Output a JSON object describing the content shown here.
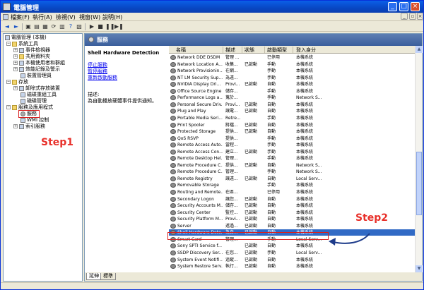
{
  "window": {
    "title": "電腦管理"
  },
  "menu": [
    "檔案(F)",
    "執行(A)",
    "檢視(V)",
    "視窗(W)",
    "說明(H)"
  ],
  "tree": {
    "root": "電腦管理 (本機)",
    "items": [
      "系統工具",
      "事件檢視器",
      "共用資料夾",
      "本機使用者和群組",
      "效能記錄及警示",
      "裝置管理員",
      "存放",
      "卸除式存放裝置",
      "磁碟重組工具",
      "磁碟管理",
      "服務及應用程式",
      "服務",
      "WMI 控制",
      "索引服務"
    ]
  },
  "annotations": {
    "step1": "Step1",
    "step2": "Step2"
  },
  "panel": {
    "title": "服務",
    "selected_service": "Shell Hardware Detection",
    "links": [
      "停止服務",
      "暫停服務",
      "重新啟動服務"
    ],
    "desc_label": "描述:",
    "desc_text": "為自動播放硬體事件提供通知。"
  },
  "columns": [
    "名稱",
    "描述",
    "狀態",
    "啟動類型",
    "登入身分"
  ],
  "services": [
    {
      "name": "Network DDE DSDM",
      "desc": "管理 ...",
      "status": "",
      "startup": "已停用",
      "logon": "本機系統"
    },
    {
      "name": "Network Location A...",
      "desc": "收集...",
      "status": "已啟動",
      "startup": "手動",
      "logon": "本機系統"
    },
    {
      "name": "Network Provisionin...",
      "desc": "在網...",
      "status": "",
      "startup": "手動",
      "logon": "本機系統"
    },
    {
      "name": "NT LM Security Sup...",
      "desc": "為遠...",
      "status": "",
      "startup": "手動",
      "logon": "本機系統"
    },
    {
      "name": "NVIDIA Display Dri...",
      "desc": "Provi...",
      "status": "已啟動",
      "startup": "自動",
      "logon": "本機系統"
    },
    {
      "name": "Office Source Engine",
      "desc": "儲存...",
      "status": "",
      "startup": "手動",
      "logon": "本機系統"
    },
    {
      "name": "Performance Logs a...",
      "desc": "蒐於...",
      "status": "",
      "startup": "手動",
      "logon": "Network S..."
    },
    {
      "name": "Personal Secure Driv...",
      "desc": "Provi...",
      "status": "已啟動",
      "startup": "自動",
      "logon": "本機系統"
    },
    {
      "name": "Plug and Play",
      "desc": "讓電...",
      "status": "已啟動",
      "startup": "自動",
      "logon": "本機系統"
    },
    {
      "name": "Portable Media Seri...",
      "desc": "Retre...",
      "status": "",
      "startup": "手動",
      "logon": "本機系統"
    },
    {
      "name": "Print Spooler",
      "desc": "將檔...",
      "status": "已啟動",
      "startup": "自動",
      "logon": "本機系統"
    },
    {
      "name": "Protected Storage",
      "desc": "提供...",
      "status": "已啟動",
      "startup": "自動",
      "logon": "本機系統"
    },
    {
      "name": "QoS RSVP",
      "desc": "提供...",
      "status": "",
      "startup": "手動",
      "logon": "本機系統"
    },
    {
      "name": "Remote Access Auto...",
      "desc": "當程...",
      "status": "",
      "startup": "手動",
      "logon": "本機系統"
    },
    {
      "name": "Remote Access Con...",
      "desc": "建立...",
      "status": "已啟動",
      "startup": "手動",
      "logon": "本機系統"
    },
    {
      "name": "Remote Desktop Hel...",
      "desc": "管理...",
      "status": "",
      "startup": "手動",
      "logon": "本機系統"
    },
    {
      "name": "Remote Procedure C...",
      "desc": "提供...",
      "status": "已啟動",
      "startup": "自動",
      "logon": "Network S..."
    },
    {
      "name": "Remote Procedure C...",
      "desc": "管理...",
      "status": "",
      "startup": "手動",
      "logon": "Network S..."
    },
    {
      "name": "Remote Registry",
      "desc": "讓遠...",
      "status": "已啟動",
      "startup": "自動",
      "logon": "Local Serv..."
    },
    {
      "name": "Removable Storage",
      "desc": "",
      "status": "",
      "startup": "手動",
      "logon": "本機系統"
    },
    {
      "name": "Routing and Remote...",
      "desc": "在區...",
      "status": "",
      "startup": "已停用",
      "logon": "本機系統"
    },
    {
      "name": "Secondary Logon",
      "desc": "讓您...",
      "status": "已啟動",
      "startup": "自動",
      "logon": "本機系統"
    },
    {
      "name": "Security Accounts M...",
      "desc": "儲存...",
      "status": "已啟動",
      "startup": "自動",
      "logon": "本機系統"
    },
    {
      "name": "Security Center",
      "desc": "監控...",
      "status": "已啟動",
      "startup": "自動",
      "logon": "本機系統"
    },
    {
      "name": "Security Platform M...",
      "desc": "Provi...",
      "status": "已啟動",
      "startup": "自動",
      "logon": "本機系統"
    },
    {
      "name": "Server",
      "desc": "透過...",
      "status": "已啟動",
      "startup": "自動",
      "logon": "本機系統"
    },
    {
      "name": "Shell Hardware Dete...",
      "desc": "為自...",
      "status": "已啟動",
      "startup": "自動",
      "logon": "本機系統",
      "selected": true
    },
    {
      "name": "Smart Card",
      "desc": "管理...",
      "status": "",
      "startup": "手動",
      "logon": "Local Serv..."
    },
    {
      "name": "Sony SPTI Service f...",
      "desc": "",
      "status": "已啟動",
      "startup": "自動",
      "logon": "本機系統"
    },
    {
      "name": "SSDP Discovery Ser...",
      "desc": "在您...",
      "status": "已啟動",
      "startup": "手動",
      "logon": "Local Serv..."
    },
    {
      "name": "System Event Notifi...",
      "desc": "追蹤...",
      "status": "已啟動",
      "startup": "自動",
      "logon": "本機系統"
    },
    {
      "name": "System Restore Serv...",
      "desc": "執行...",
      "status": "已啟動",
      "startup": "自動",
      "logon": "本機系統"
    }
  ],
  "tabs": [
    "延伸",
    "標準"
  ]
}
